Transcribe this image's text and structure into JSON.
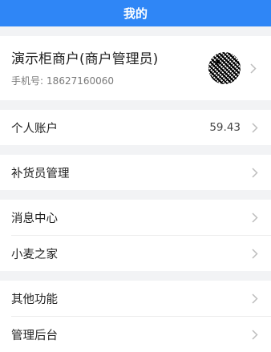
{
  "header": {
    "title": "我的"
  },
  "profile": {
    "name": "演示柜商户(商户管理员)",
    "phone_label": "手机号:",
    "phone": "18627160060"
  },
  "menu": {
    "account": {
      "label": "个人账户",
      "value": "59.43"
    },
    "restock": {
      "label": "补货员管理"
    },
    "messages": {
      "label": "消息中心"
    },
    "home": {
      "label": "小麦之家"
    },
    "other": {
      "label": "其他功能"
    },
    "admin": {
      "label": "管理后台"
    }
  },
  "icons": {
    "qr": "qr-code-icon",
    "chevron": "chevron-right-icon"
  },
  "colors": {
    "accent": "#2f86f6",
    "background": "#f2f3f5"
  }
}
